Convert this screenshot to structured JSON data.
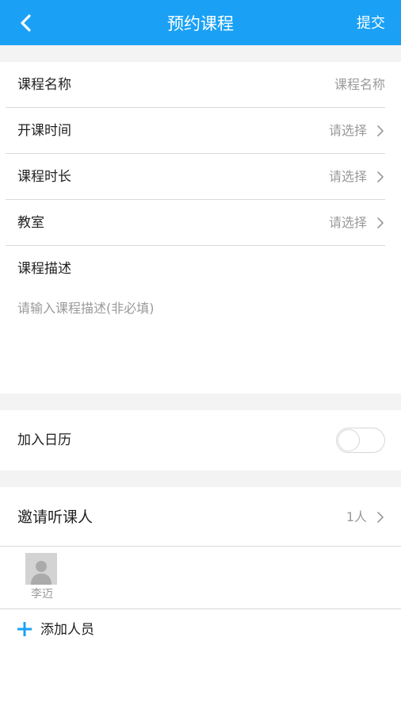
{
  "header": {
    "back_icon": "chevron-left-icon",
    "title": "预约课程",
    "submit_label": "提交"
  },
  "colors": {
    "header_bg": "#1aa1f5",
    "accent": "#1aa1f5",
    "section_gap": "#f3f3f3",
    "placeholder": "#9a9a9a"
  },
  "form": {
    "course_name": {
      "label": "课程名称",
      "placeholder": "课程名称"
    },
    "start_time": {
      "label": "开课时间",
      "value": "请选择"
    },
    "duration": {
      "label": "课程时长",
      "value": "请选择"
    },
    "classroom": {
      "label": "教室",
      "value": "请选择"
    },
    "description": {
      "label": "课程描述",
      "placeholder": "请输入课程描述(非必填)"
    }
  },
  "calendar": {
    "label": "加入日历",
    "enabled": false
  },
  "invite": {
    "label": "邀请听课人",
    "count": "1人",
    "attendees": [
      {
        "name": "李迈",
        "avatar_icon": "default-avatar-icon"
      }
    ],
    "add_label": "添加人员",
    "add_icon": "plus-icon"
  }
}
